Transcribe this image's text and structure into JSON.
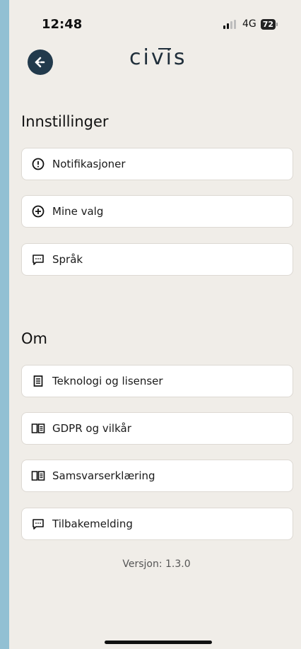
{
  "status_bar": {
    "time": "12:48",
    "network": "4G",
    "battery": "72",
    "signal_bars_filled": 2,
    "signal_bars_total": 4
  },
  "header": {
    "logo": "civis",
    "back_icon": "arrow-left-icon"
  },
  "sections": {
    "settings": {
      "title": "Innstillinger",
      "items": [
        {
          "label": "Notifikasjoner",
          "icon": "alert-circle-icon"
        },
        {
          "label": "Mine valg",
          "icon": "plus-circle-icon"
        },
        {
          "label": "Språk",
          "icon": "chat-icon"
        }
      ]
    },
    "about": {
      "title": "Om",
      "items": [
        {
          "label": "Teknologi og lisenser",
          "icon": "document-icon"
        },
        {
          "label": "GDPR og vilkår",
          "icon": "book-icon"
        },
        {
          "label": "Samsvarserklæring",
          "icon": "book-icon"
        },
        {
          "label": "Tilbakemelding",
          "icon": "chat-icon"
        }
      ]
    }
  },
  "footer": {
    "version": "Versjon: 1.3.0"
  },
  "colors": {
    "accent": "#223a4c",
    "background": "#f0ede8",
    "frame": "#92c0d3"
  }
}
